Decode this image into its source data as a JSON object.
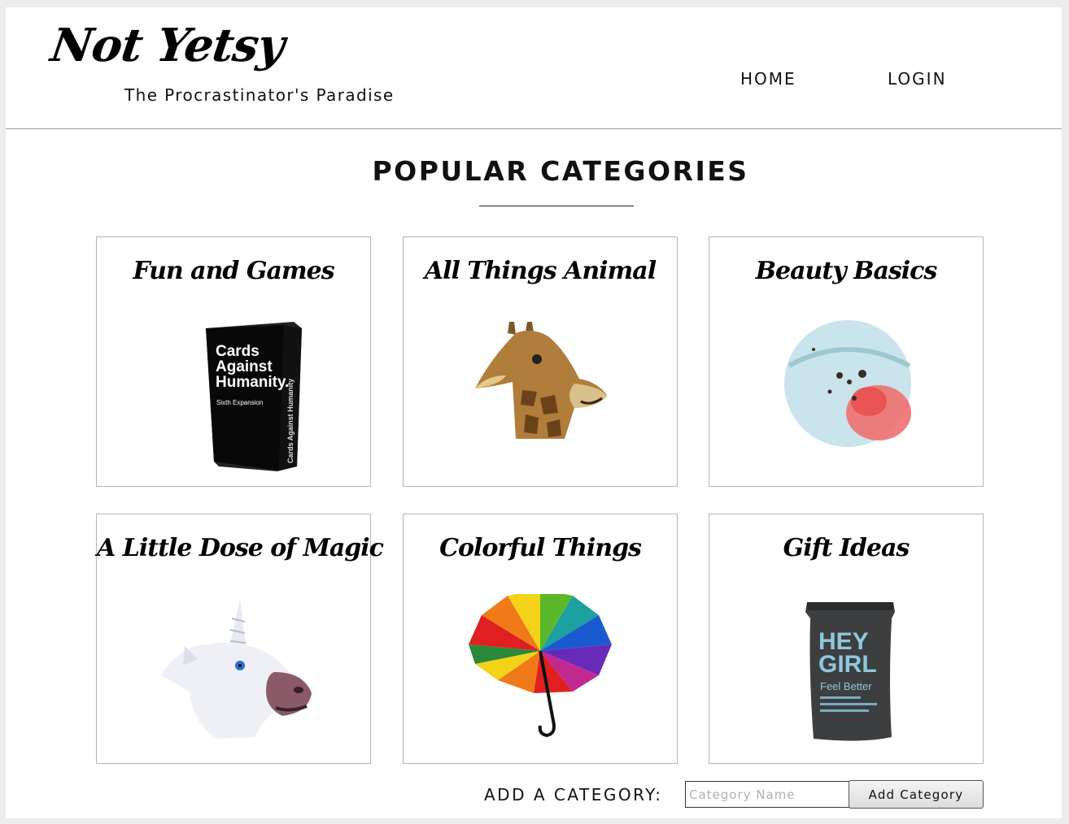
{
  "header": {
    "logo": "Not Yetsy",
    "tagline": "The Procrastinator's Paradise",
    "nav": {
      "home": "HOME",
      "login": "LOGIN"
    }
  },
  "main": {
    "section_title": "POPULAR CATEGORIES",
    "categories": [
      {
        "title": "Fun and Games",
        "image": "card-game-box-image",
        "box_text": [
          "Cards",
          "Against",
          "Humanity."
        ],
        "box_subtext": "Sixth Expansion",
        "box_side": "Cards Against Humanity"
      },
      {
        "title": "All Things Animal",
        "image": "giraffe-mask-image"
      },
      {
        "title": "Beauty Basics",
        "image": "bath-bomb-image"
      },
      {
        "title": "A Little Dose of Magic",
        "image": "unicorn-mask-image"
      },
      {
        "title": "Colorful Things",
        "image": "rainbow-umbrella-image"
      },
      {
        "title": "Gift Ideas",
        "image": "hey-girl-pouch-image",
        "pouch_text": [
          "HEY",
          "GIRL"
        ],
        "pouch_sub": "Feel Better"
      }
    ]
  },
  "add_category": {
    "label": "ADD A CATEGORY:",
    "placeholder": "Category Name",
    "value": "",
    "button_label": "Add Category"
  },
  "colors": {
    "background": "#ececec",
    "panel": "#ffffff",
    "card_border": "#b5b5b5",
    "text": "#111111"
  }
}
